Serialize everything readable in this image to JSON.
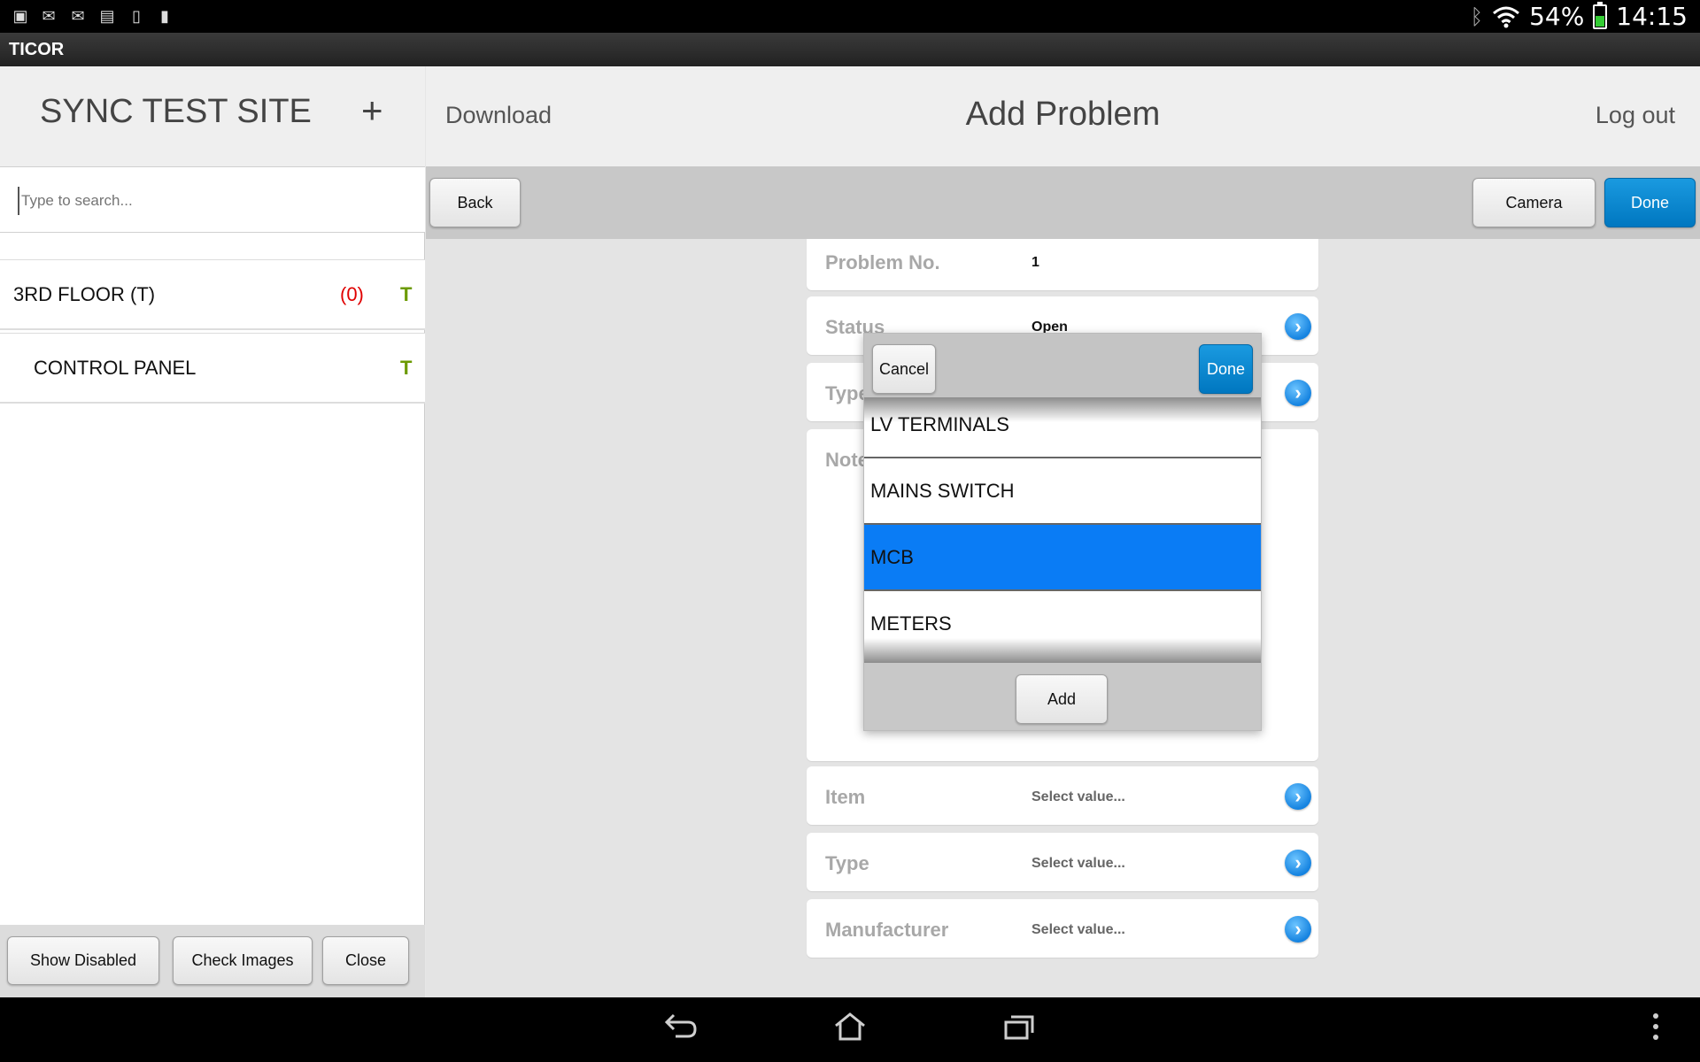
{
  "status_bar": {
    "left_icons": [
      "gallery-icon",
      "email-icon",
      "gmail-icon",
      "news-icon",
      "phone-icon",
      "sd-card-icon"
    ],
    "battery": "54%",
    "time": "14:15",
    "battery_color": "#33cc33"
  },
  "app": {
    "title": "TICOR"
  },
  "sidebar": {
    "site_title": "SYNC TEST SITE",
    "add_label": "+",
    "search": {
      "placeholder": "Type to search...",
      "value": ""
    },
    "items": [
      {
        "label": "3RD FLOOR (T)",
        "count": "(0)",
        "flag": "T"
      },
      {
        "label": "CONTROL PANEL",
        "count": "",
        "flag": "T"
      }
    ],
    "footer": {
      "show_disabled": "Show Disabled",
      "check_images": "Check Images",
      "close": "Close"
    }
  },
  "header": {
    "download": "Download",
    "title": "Add Problem",
    "logout": "Log out"
  },
  "toolbar": {
    "back": "Back",
    "camera": "Camera",
    "done": "Done"
  },
  "form": {
    "problem_no": {
      "label": "Problem No.",
      "value": "1"
    },
    "status": {
      "label": "Status",
      "value": "Open"
    },
    "type_top": {
      "label": "Type",
      "value": ""
    },
    "notes": {
      "label": "Notes",
      "value": ""
    },
    "item": {
      "label": "Item",
      "value": "Select value..."
    },
    "type": {
      "label": "Type",
      "value": "Select value..."
    },
    "manufacturer": {
      "label": "Manufacturer",
      "value": "Select value..."
    }
  },
  "picker": {
    "cancel": "Cancel",
    "done": "Done",
    "options": [
      "LV TERMINALS",
      "MAINS SWITCH",
      "MCB",
      "METERS"
    ],
    "selected": "MCB",
    "add": "Add",
    "accent_color": "#0a7cf5"
  },
  "colors": {
    "accent": "#0077c0",
    "error_count": "#e00000",
    "flag": "#6b9a00"
  }
}
